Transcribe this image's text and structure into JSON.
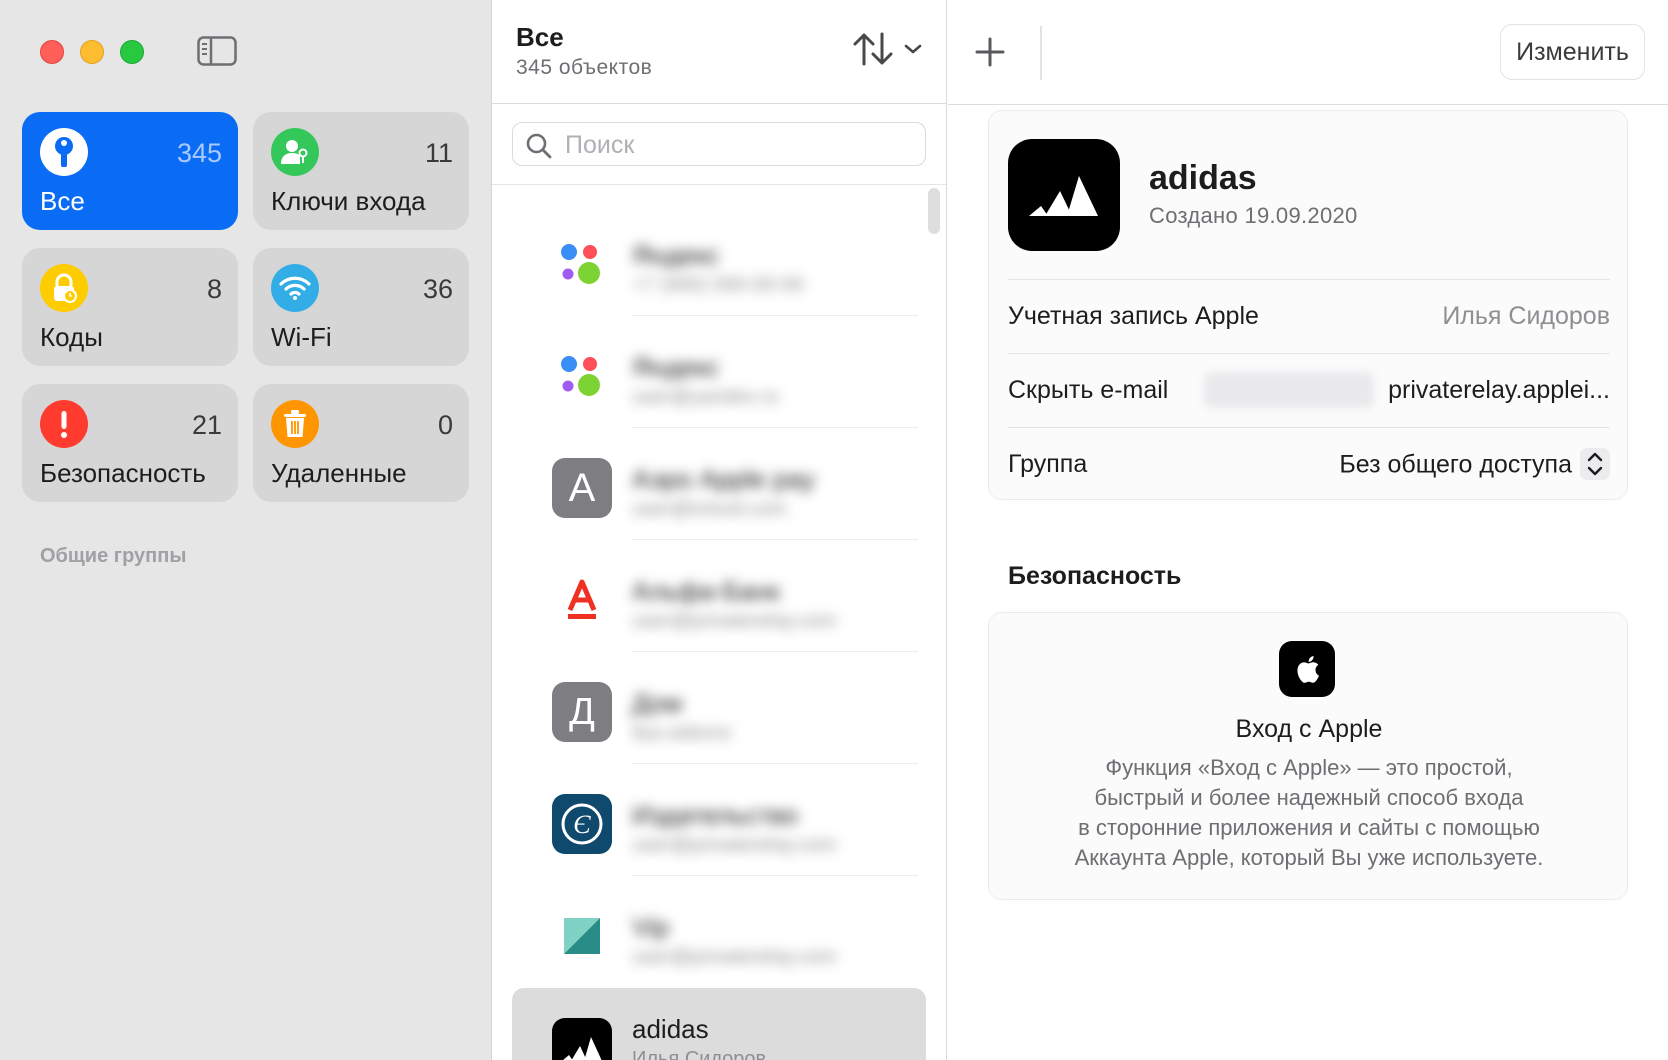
{
  "sidebar": {
    "tiles": [
      {
        "label": "Все",
        "count": "345",
        "icon": "key-icon",
        "color": "#0a6cf5",
        "selected": true
      },
      {
        "label": "Ключи входа",
        "count": "11",
        "icon": "passkey-person-icon",
        "color": "#34c759"
      },
      {
        "label": "Коды",
        "count": "8",
        "icon": "lock-clock-icon",
        "color": "#ffcc00"
      },
      {
        "label": "Wi-Fi",
        "count": "36",
        "icon": "wifi-icon",
        "color": "#32ade6"
      },
      {
        "label": "Безопасность",
        "count": "21",
        "icon": "exclamation-icon",
        "color": "#ff3b30"
      },
      {
        "label": "Удаленные",
        "count": "0",
        "icon": "trash-icon",
        "color": "#ff9500"
      }
    ],
    "section_label": "Общие группы"
  },
  "list": {
    "title": "Все",
    "subtitle": "345 объектов",
    "search_placeholder": "Поиск",
    "items": [
      {
        "title": "Яндекс",
        "subtitle": "+7 (900) 000-00-00",
        "icon": "yandex-dots-icon"
      },
      {
        "title": "Яндекс",
        "subtitle": "user@yandex.ru",
        "icon": "yandex-dots-icon"
      },
      {
        "title": "Аэро Apple pay",
        "subtitle": "user@icloud.com",
        "icon": "letter-a-icon"
      },
      {
        "title": "Альфа-Банк",
        "subtitle": "user@privaterelay.com",
        "icon": "alfa-bank-icon"
      },
      {
        "title": "Дом",
        "subtitle": "ilya.sidorov",
        "icon": "letter-d-icon"
      },
      {
        "title": "Издательство",
        "subtitle": "user@privaterelay.com",
        "icon": "e-emblem-icon"
      },
      {
        "title": "Vip",
        "subtitle": "user@privaterelay.com",
        "icon": "teal-square-icon"
      },
      {
        "title": "adidas",
        "subtitle": "Илья Сидоров",
        "icon": "adidas-icon",
        "selected": true
      }
    ]
  },
  "detail": {
    "add_label": "+",
    "edit_label": "Изменить",
    "name": "adidas",
    "created": "Создано 19.09.2020",
    "fields": [
      {
        "label": "Учетная запись Apple",
        "value": "Илья Сидоров"
      },
      {
        "label": "Скрыть e-mail",
        "value": "privaterelay.applei..."
      },
      {
        "label": "Группа",
        "value": "Без общего доступа"
      }
    ],
    "security_heading": "Безопасность",
    "security_card": {
      "title": "Вход с Apple",
      "description_lines": [
        "Функция «Вход с Apple» — это простой,",
        "быстрый и более надежный способ входа",
        "в сторонние приложения и сайты с помощью",
        "Аккаунта Apple, который Вы уже используете."
      ]
    }
  }
}
